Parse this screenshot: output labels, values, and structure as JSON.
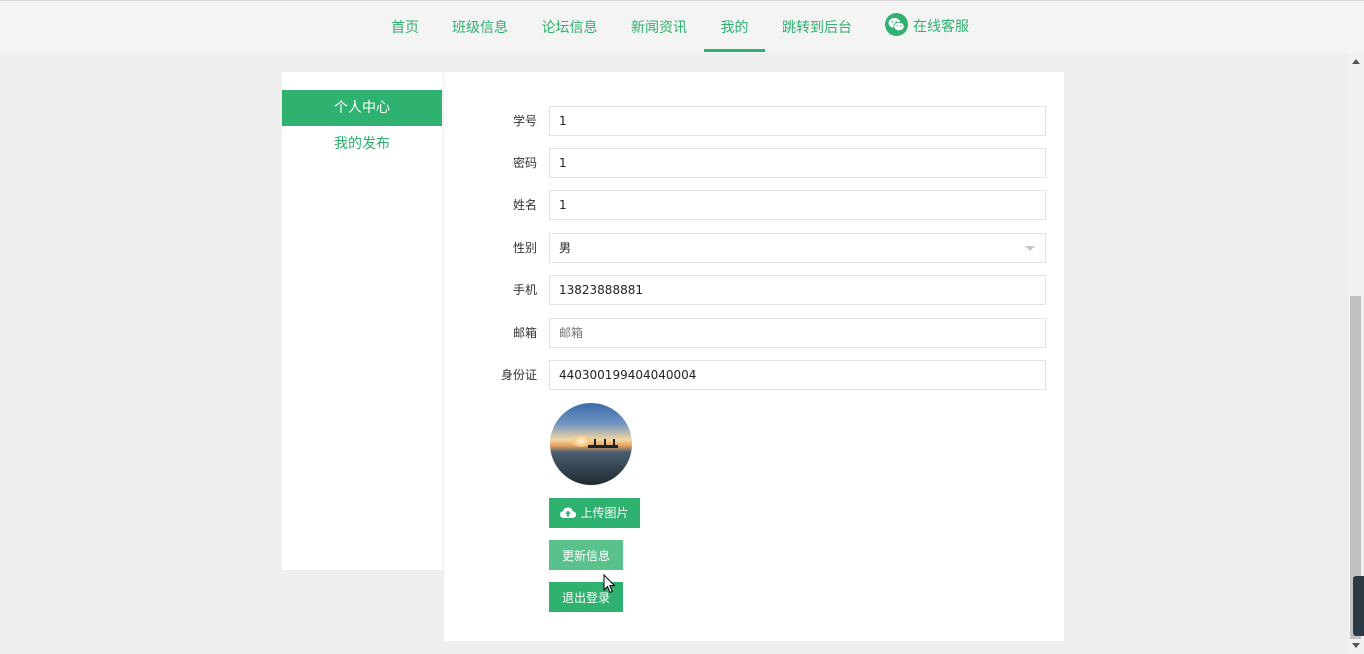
{
  "nav": {
    "items": [
      {
        "label": "首页"
      },
      {
        "label": "班级信息"
      },
      {
        "label": "论坛信息"
      },
      {
        "label": "新闻资讯"
      },
      {
        "label": "我的"
      },
      {
        "label": "跳转到后台"
      }
    ],
    "active": "我的",
    "service_label": "在线客服",
    "service_icon": "wechat-icon"
  },
  "sidebar": {
    "items": [
      {
        "label": "个人中心",
        "active": true
      },
      {
        "label": "我的发布",
        "active": false
      }
    ]
  },
  "form": {
    "fields": [
      {
        "label": "学号",
        "value": "1",
        "placeholder": ""
      },
      {
        "label": "密码",
        "value": "1",
        "placeholder": ""
      },
      {
        "label": "姓名",
        "value": "1",
        "placeholder": ""
      },
      {
        "label": "性别",
        "value": "男",
        "placeholder": ""
      },
      {
        "label": "手机",
        "value": "13823888881",
        "placeholder": ""
      },
      {
        "label": "邮箱",
        "value": "",
        "placeholder": "邮箱"
      },
      {
        "label": "身份证",
        "value": "440300199404040004",
        "placeholder": ""
      }
    ],
    "avatar_icon": "sunset-photo",
    "upload_icon": "cloud-upload-icon",
    "upload_label": "上传图片",
    "update_label": "更新信息",
    "logout_label": "退出登录"
  },
  "colors": {
    "accent": "#2fb16f",
    "background": "#efefef"
  }
}
